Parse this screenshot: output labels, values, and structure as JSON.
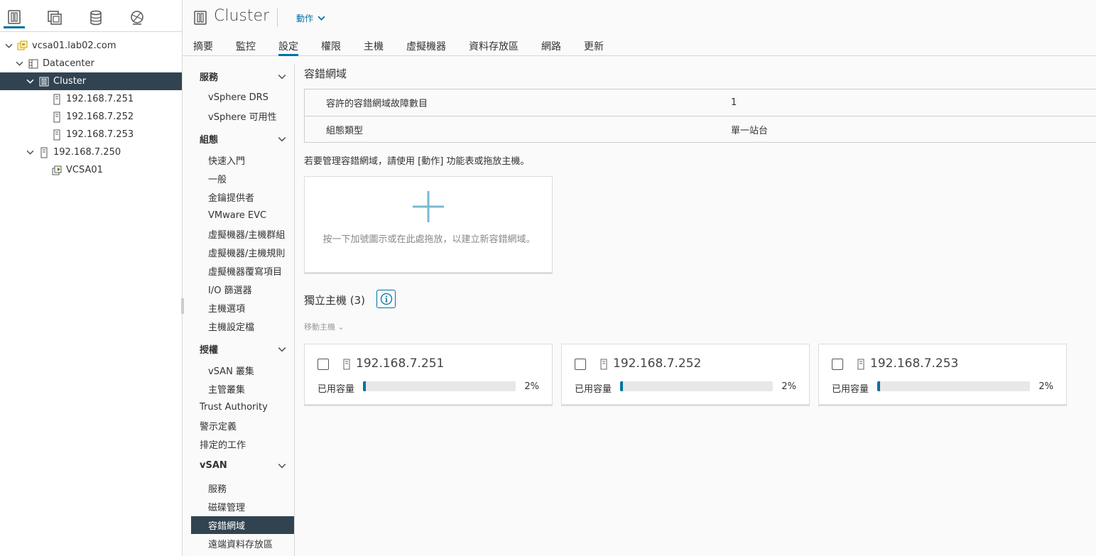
{
  "navigator": {
    "tabs": [
      {
        "icon": "hosts-clusters-icon",
        "active": true
      },
      {
        "icon": "vms-templates-icon",
        "active": false
      },
      {
        "icon": "storage-icon",
        "active": false
      },
      {
        "icon": "networking-icon",
        "active": false
      }
    ],
    "tree": [
      {
        "label": "vcsa01.lab02.com",
        "level": 0,
        "expanded": true,
        "icon": "vcenter-icon",
        "selected": false
      },
      {
        "label": "Datacenter",
        "level": 1,
        "expanded": true,
        "icon": "datacenter-icon",
        "selected": false
      },
      {
        "label": "Cluster",
        "level": 2,
        "expanded": true,
        "icon": "cluster-icon",
        "selected": true
      },
      {
        "label": "192.168.7.251",
        "level": 3,
        "expanded": null,
        "icon": "host-icon",
        "selected": false
      },
      {
        "label": "192.168.7.252",
        "level": 3,
        "expanded": null,
        "icon": "host-icon",
        "selected": false
      },
      {
        "label": "192.168.7.253",
        "level": 3,
        "expanded": null,
        "icon": "host-icon",
        "selected": false
      },
      {
        "label": "192.168.7.250",
        "level": 2,
        "expanded": true,
        "icon": "host-icon",
        "selected": false
      },
      {
        "label": "VCSA01",
        "level": 3,
        "expanded": null,
        "icon": "vm-running-icon",
        "selected": false
      }
    ]
  },
  "header": {
    "title": "Cluster",
    "actions_label": "動作"
  },
  "tabs": [
    "摘要",
    "監控",
    "設定",
    "權限",
    "主機",
    "虛擬機器",
    "資料存放區",
    "網路",
    "更新"
  ],
  "active_tab": "設定",
  "settings_nav": {
    "groups": [
      {
        "title": "服務",
        "items": [
          "vSphere DRS",
          "vSphere 可用性"
        ]
      },
      {
        "title": "組態",
        "items": [
          "快速入門",
          "一般",
          "金鑰提供者",
          "VMware EVC",
          "虛擬機器/主機群組",
          "虛擬機器/主機規則",
          "虛擬機器覆寫項目",
          "I/O 篩選器",
          "主機選項",
          "主機設定檔"
        ]
      },
      {
        "title": "授權",
        "items": [
          "vSAN 叢集",
          "主管叢集"
        ]
      }
    ],
    "top_items": [
      "Trust Authority",
      "警示定義",
      "排定的工作"
    ],
    "vsan_group": {
      "title": "vSAN",
      "items": [
        "服務",
        "磁碟管理",
        "容錯網域",
        "遠端資料存放區"
      ]
    },
    "selected": "容錯網域"
  },
  "fault_domains": {
    "title": "容錯網域",
    "rows": [
      {
        "key": "容許的容錯網域故障數目",
        "value": "1"
      },
      {
        "key": "組態類型",
        "value": "單一站台"
      }
    ],
    "manage_hint": "若要管理容錯網域，請使用 [動作] 功能表或拖放主機。",
    "drop_text": "按一下加號圖示或在此處拖放，以建立新容錯網域。"
  },
  "standalone_hosts": {
    "title": "獨立主機 (3)",
    "move_label": "移動主機",
    "capacity_label": "已用容量",
    "hosts": [
      {
        "name": "192.168.7.251",
        "used_pct": "2%",
        "used": 0.02
      },
      {
        "name": "192.168.7.252",
        "used_pct": "2%",
        "used": 0.02
      },
      {
        "name": "192.168.7.253",
        "used_pct": "2%",
        "used": 0.02
      }
    ]
  }
}
